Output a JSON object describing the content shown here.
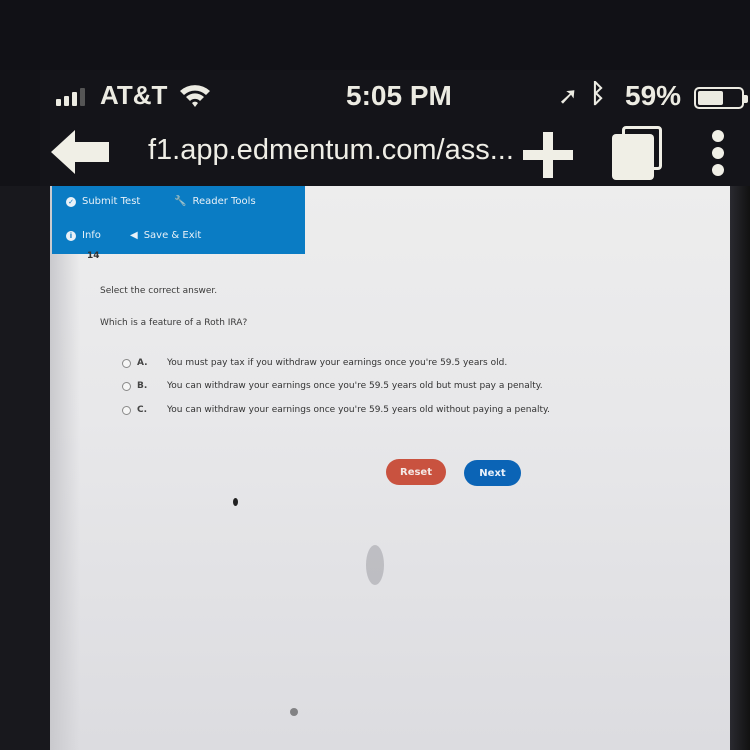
{
  "status_bar": {
    "carrier": "AT&T",
    "time": "5:05 PM",
    "battery_percent_label": "59%",
    "battery_level": 0.59,
    "icons": [
      "signal-icon",
      "wifi-icon",
      "location-arrow-icon",
      "bluetooth-icon",
      "battery-icon"
    ]
  },
  "browser": {
    "url": "f1.app.edmentum.com/ass...",
    "icons": {
      "back": "back-arrow-icon",
      "new_tab": "plus-icon",
      "tabs": "tabs-icon",
      "menu": "more-vertical-icon"
    }
  },
  "toolbar": {
    "submit_test": "Submit Test",
    "reader_tools": "Reader Tools",
    "info": "Info",
    "save_exit": "Save & Exit",
    "accent": "#0a7cc4"
  },
  "question": {
    "number": "14",
    "instruction": "Select the correct answer.",
    "prompt": "Which is a feature of a Roth IRA?",
    "options": [
      {
        "letter": "A.",
        "text": "You must pay tax if you withdraw your earnings once you're 59.5 years old."
      },
      {
        "letter": "B.",
        "text": "You can withdraw your earnings once you're 59.5 years old but must pay a penalty."
      },
      {
        "letter": "C.",
        "text": "You can withdraw your earnings once you're 59.5 years old without paying a penalty."
      }
    ]
  },
  "actions": {
    "reset": "Reset",
    "next": "Next",
    "reset_color": "#c9523f",
    "next_color": "#0b64b6"
  }
}
